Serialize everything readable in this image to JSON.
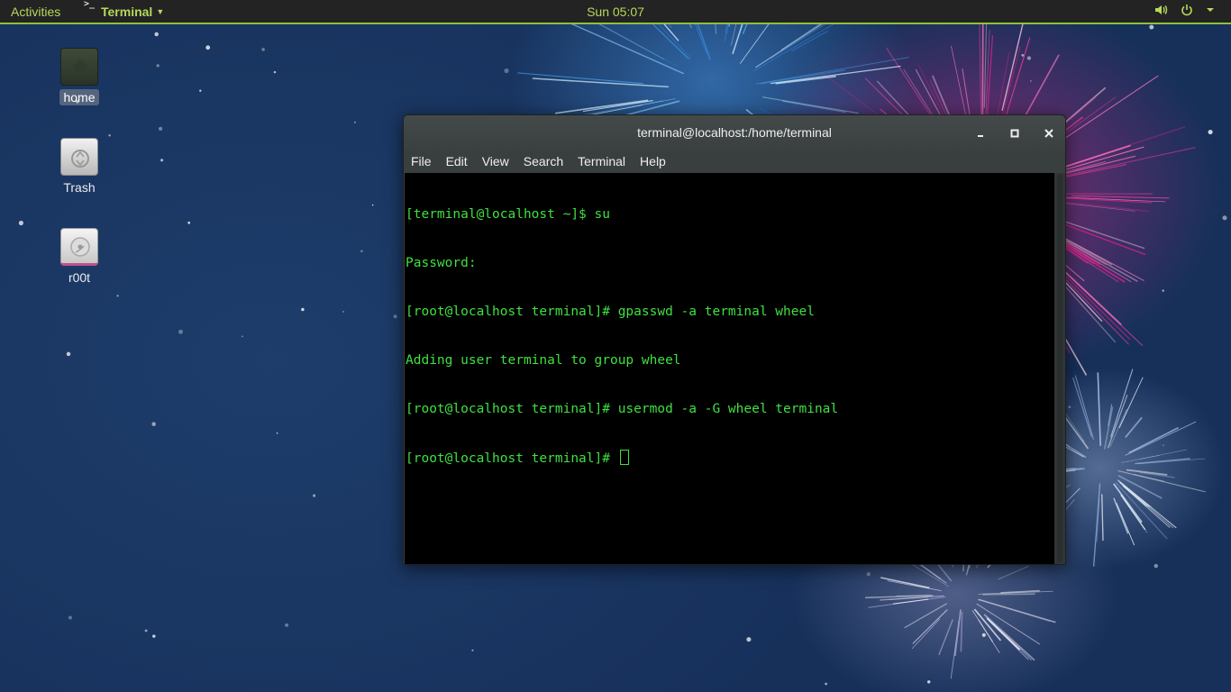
{
  "top_bar": {
    "activities_label": "Activities",
    "app_menu_label": "Terminal",
    "app_menu_glyph": ">_",
    "clock": "Sun 05:07",
    "icons": [
      "volume-icon",
      "power-icon",
      "chevron-down-icon"
    ]
  },
  "desktop": {
    "icons": [
      {
        "label": "home",
        "icon": "home-folder-icon"
      },
      {
        "label": "Trash",
        "icon": "trash-icon"
      },
      {
        "label": "r00t",
        "icon": "drive-icon"
      }
    ]
  },
  "terminal_window": {
    "title": "terminal@localhost:/home/terminal",
    "controls": [
      "minimize-icon",
      "maximize-icon",
      "close-icon"
    ],
    "menu": [
      "File",
      "Edit",
      "View",
      "Search",
      "Terminal",
      "Help"
    ],
    "lines": [
      "[terminal@localhost ~]$ su",
      "Password:",
      "[root@localhost terminal]# gpasswd -a terminal wheel",
      "Adding user terminal to group wheel",
      "[root@localhost terminal]# usermod -a -G wheel terminal",
      "[root@localhost terminal]# "
    ],
    "text_color": "#3fe03f",
    "background_color": "#000000"
  },
  "colors": {
    "top_bar_accent": "#8cc23a",
    "top_bar_text": "#b6d95a"
  }
}
